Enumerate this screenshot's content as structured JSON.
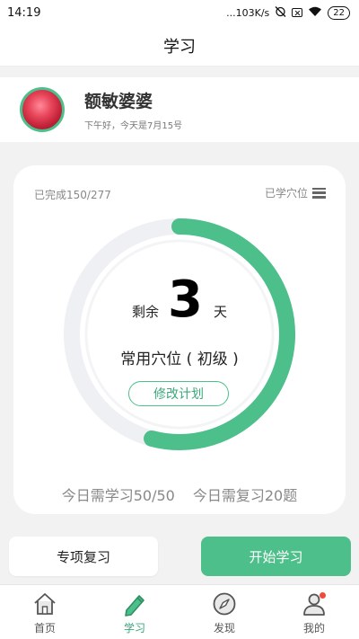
{
  "status_bar": {
    "time": "14:19",
    "network_speed": "...103K/s",
    "battery": "22"
  },
  "header": {
    "title": "学习"
  },
  "profile": {
    "name": "额敏婆婆",
    "greeting": "下午好，今天是7月15号"
  },
  "progress_card": {
    "completed_text": "已完成150/277",
    "completed": 150,
    "total": 277,
    "learned_points_label": "已学穴位",
    "remaining_prefix": "剩余",
    "remaining_days": "3",
    "remaining_suffix": "天",
    "plan_name": "常用穴位 ( 初级 )",
    "modify_plan_label": "修改计划",
    "today_study": "今日需学习50/50",
    "today_review": "今日需复习20题",
    "ring_color": "#4cbf8a",
    "ring_track_color": "#eef0f4"
  },
  "actions": {
    "special_review_label": "专项复习",
    "start_study_label": "开始学习"
  },
  "tabbar": {
    "items": [
      {
        "label": "首页",
        "icon": "home-icon"
      },
      {
        "label": "学习",
        "icon": "pen-icon"
      },
      {
        "label": "发现",
        "icon": "compass-icon"
      },
      {
        "label": "我的",
        "icon": "user-icon"
      }
    ],
    "active_color": "#3aa87a"
  }
}
